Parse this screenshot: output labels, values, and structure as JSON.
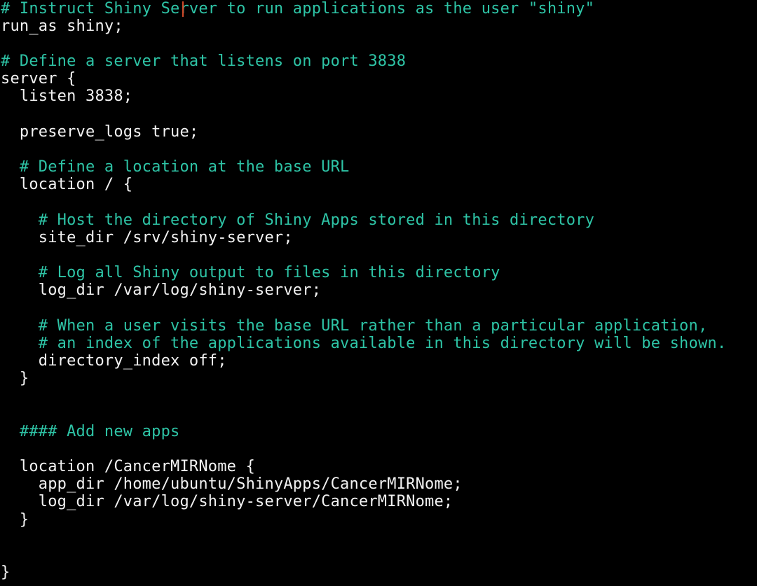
{
  "editor": {
    "colors": {
      "background": "#000000",
      "code": "#f2f2f2",
      "comment": "#2ec4a6",
      "cursor": "#d24a2a"
    },
    "lines": [
      {
        "text": "# Instruct Shiny Server to run applications as the user \"shiny\"",
        "type": "comment"
      },
      {
        "text": "run_as shiny;",
        "type": "code"
      },
      {
        "text": "",
        "type": "code"
      },
      {
        "text": "# Define a server that listens on port 3838",
        "type": "comment"
      },
      {
        "text": "server {",
        "type": "code"
      },
      {
        "text": "  listen 3838;",
        "type": "code"
      },
      {
        "text": "",
        "type": "code"
      },
      {
        "text": "  preserve_logs true;",
        "type": "code"
      },
      {
        "text": "",
        "type": "code"
      },
      {
        "text": "  # Define a location at the base URL",
        "type": "comment"
      },
      {
        "text": "  location / {",
        "type": "code"
      },
      {
        "text": "",
        "type": "code"
      },
      {
        "text": "    # Host the directory of Shiny Apps stored in this directory",
        "type": "comment"
      },
      {
        "text": "    site_dir /srv/shiny-server;",
        "type": "code"
      },
      {
        "text": "",
        "type": "code"
      },
      {
        "text": "    # Log all Shiny output to files in this directory",
        "type": "comment"
      },
      {
        "text": "    log_dir /var/log/shiny-server;",
        "type": "code"
      },
      {
        "text": "",
        "type": "code"
      },
      {
        "text": "    # When a user visits the base URL rather than a particular application,",
        "type": "comment"
      },
      {
        "text": "    # an index of the applications available in this directory will be shown.",
        "type": "comment"
      },
      {
        "text": "    directory_index off;",
        "type": "code"
      },
      {
        "text": "  }",
        "type": "code"
      },
      {
        "text": "",
        "type": "code"
      },
      {
        "text": "",
        "type": "code"
      },
      {
        "text": "  #### Add new apps",
        "type": "comment"
      },
      {
        "text": "",
        "type": "code"
      },
      {
        "text": "  location /CancerMIRNome {",
        "type": "code"
      },
      {
        "text": "    app_dir /home/ubuntu/ShinyApps/CancerMIRNome;",
        "type": "code"
      },
      {
        "text": "    log_dir /var/log/shiny-server/CancerMIRNome;",
        "type": "code"
      },
      {
        "text": "  }",
        "type": "code"
      },
      {
        "text": "",
        "type": "code"
      },
      {
        "text": "",
        "type": "code"
      },
      {
        "text": "}",
        "type": "code"
      }
    ]
  }
}
